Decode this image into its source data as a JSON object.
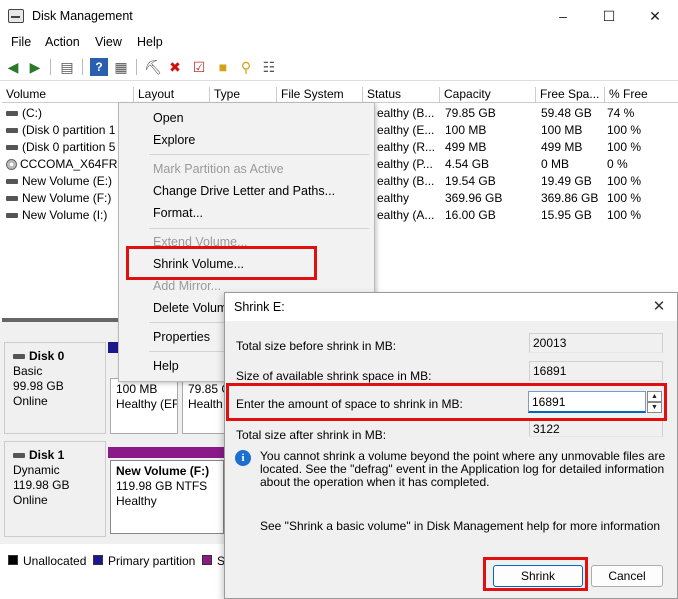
{
  "window": {
    "title": "Disk Management"
  },
  "menu": [
    "File",
    "Action",
    "View",
    "Help"
  ],
  "columns": [
    "Volume",
    "Layout",
    "Type",
    "File System",
    "Status",
    "Capacity",
    "Free Spa...",
    "% Free"
  ],
  "volumes": [
    {
      "name": "(C:)",
      "status": "ealthy (B...",
      "capacity": "79.85 GB",
      "free": "59.48 GB",
      "pct": "74 %",
      "icon": "drive"
    },
    {
      "name": "(Disk 0 partition 1",
      "status": "ealthy (E...",
      "capacity": "100 MB",
      "free": "100 MB",
      "pct": "100 %",
      "icon": "drive"
    },
    {
      "name": "(Disk 0 partition 5",
      "status": "ealthy (R...",
      "capacity": "499 MB",
      "free": "499 MB",
      "pct": "100 %",
      "icon": "drive"
    },
    {
      "name": "CCCOMA_X64FRE",
      "status": "ealthy (P...",
      "capacity": "4.54 GB",
      "free": "0 MB",
      "pct": "0 %",
      "icon": "cd"
    },
    {
      "name": "New Volume (E:)",
      "status": "ealthy (B...",
      "capacity": "19.54 GB",
      "free": "19.49 GB",
      "pct": "100 %",
      "icon": "drive"
    },
    {
      "name": "New Volume (F:)",
      "status": "ealthy",
      "capacity": "369.96 GB",
      "free": "369.86 GB",
      "pct": "100 %",
      "icon": "drive"
    },
    {
      "name": "New Volume (I:)",
      "status": "ealthy (A...",
      "capacity": "16.00 GB",
      "free": "15.95 GB",
      "pct": "100 %",
      "icon": "drive"
    }
  ],
  "context_menu": {
    "open": "Open",
    "explore": "Explore",
    "mark_active": "Mark Partition as Active",
    "change_letter": "Change Drive Letter and Paths...",
    "format": "Format...",
    "extend": "Extend Volume...",
    "shrink": "Shrink Volume...",
    "add_mirror": "Add Mirror...",
    "delete": "Delete Volume...",
    "properties": "Properties",
    "help": "Help"
  },
  "disks": [
    {
      "name": "Disk 0",
      "type": "Basic",
      "size": "99.98 GB",
      "state": "Online"
    },
    {
      "name": "Disk 1",
      "type": "Dynamic",
      "size": "119.98 GB",
      "state": "Online"
    }
  ],
  "disk0_parts": [
    {
      "size": "100 MB",
      "status": "Healthy (EF"
    },
    {
      "size": "79.85 G",
      "status": "Health"
    }
  ],
  "disk1_part": {
    "name": "New Volume  (F:)",
    "size": "119.98 GB NTFS",
    "status": "Healthy"
  },
  "legend": [
    "Unallocated",
    "Primary partition",
    "S"
  ],
  "colors": {
    "unallocated": "#000000",
    "primary": "#1a1a8a",
    "simple": "#8a1a8a",
    "highlight": "#e01010",
    "accent": "#0067c0"
  },
  "dialog": {
    "title": "Shrink E:",
    "total_before_label": "Total size before shrink in MB:",
    "total_before_value": "20013",
    "available_label": "Size of available shrink space in MB:",
    "available_value": "16891",
    "amount_label": "Enter the amount of space to shrink in MB:",
    "amount_value": "16891",
    "after_label": "Total size after shrink in MB:",
    "after_value": "3122",
    "info_text": "You cannot shrink a volume beyond the point where any unmovable files are located. See the \"defrag\" event in the Application log for detailed information about the operation when it has completed.",
    "help_text": "See \"Shrink a basic volume\" in Disk Management help for more information",
    "shrink_button": "Shrink",
    "cancel_button": "Cancel"
  }
}
